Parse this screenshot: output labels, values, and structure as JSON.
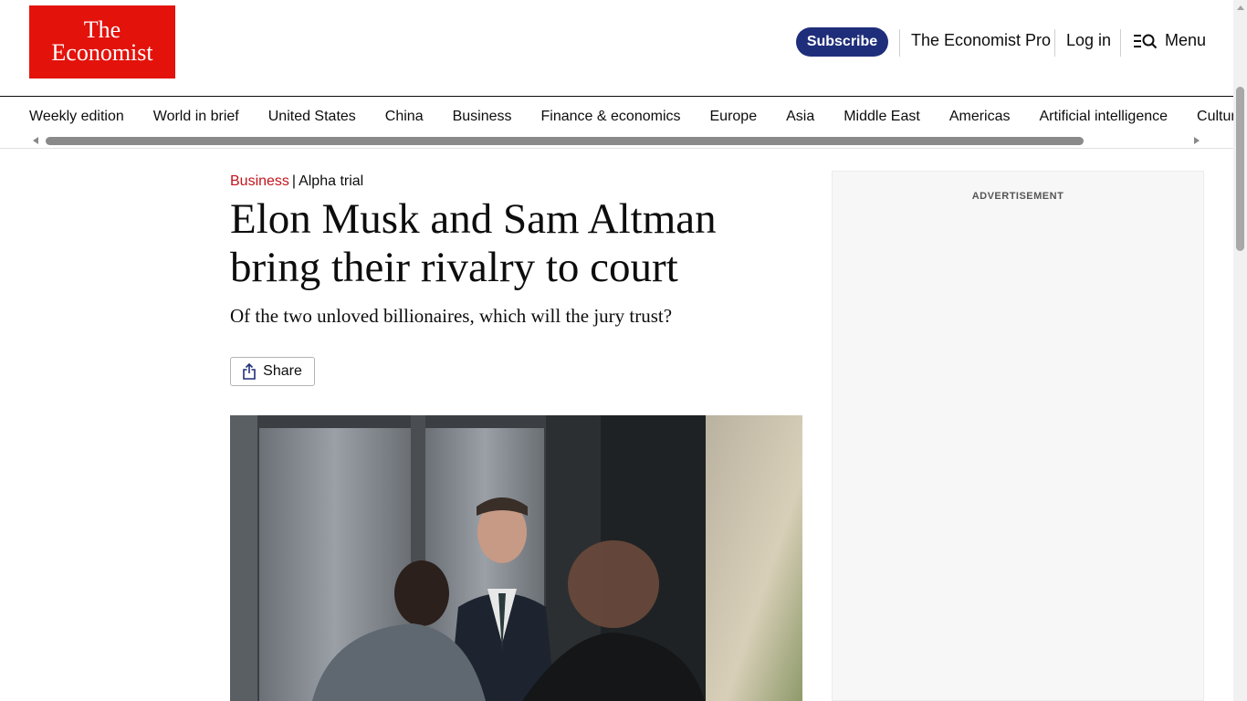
{
  "logo": {
    "line1": "The",
    "line2": "Economist",
    "color": "#e3120b"
  },
  "header": {
    "subscribe_label": "Subscribe",
    "pro_label": "The Economist Pro",
    "login_label": "Log in",
    "menu_label": "Menu",
    "menu_icon": "search-menu-icon"
  },
  "nav": {
    "items": [
      "Weekly edition",
      "World in brief",
      "United States",
      "China",
      "Business",
      "Finance & economics",
      "Europe",
      "Asia",
      "Middle East",
      "Americas",
      "Artificial intelligence",
      "Culture"
    ]
  },
  "article": {
    "section": "Business",
    "separator": "|",
    "topic": "Alpha trial",
    "headline": "Elon Musk and Sam Altman bring their rivalry to court",
    "subheadline": "Of the two unloved billionaires, which will the jury trust?",
    "share_label": "Share",
    "share_icon": "share-icon",
    "section_color": "#c2151d"
  },
  "ad": {
    "label": "ADVERTISEMENT"
  },
  "colors": {
    "subscribe_bg": "#1f2e7a",
    "text": "#0d0d0d"
  }
}
